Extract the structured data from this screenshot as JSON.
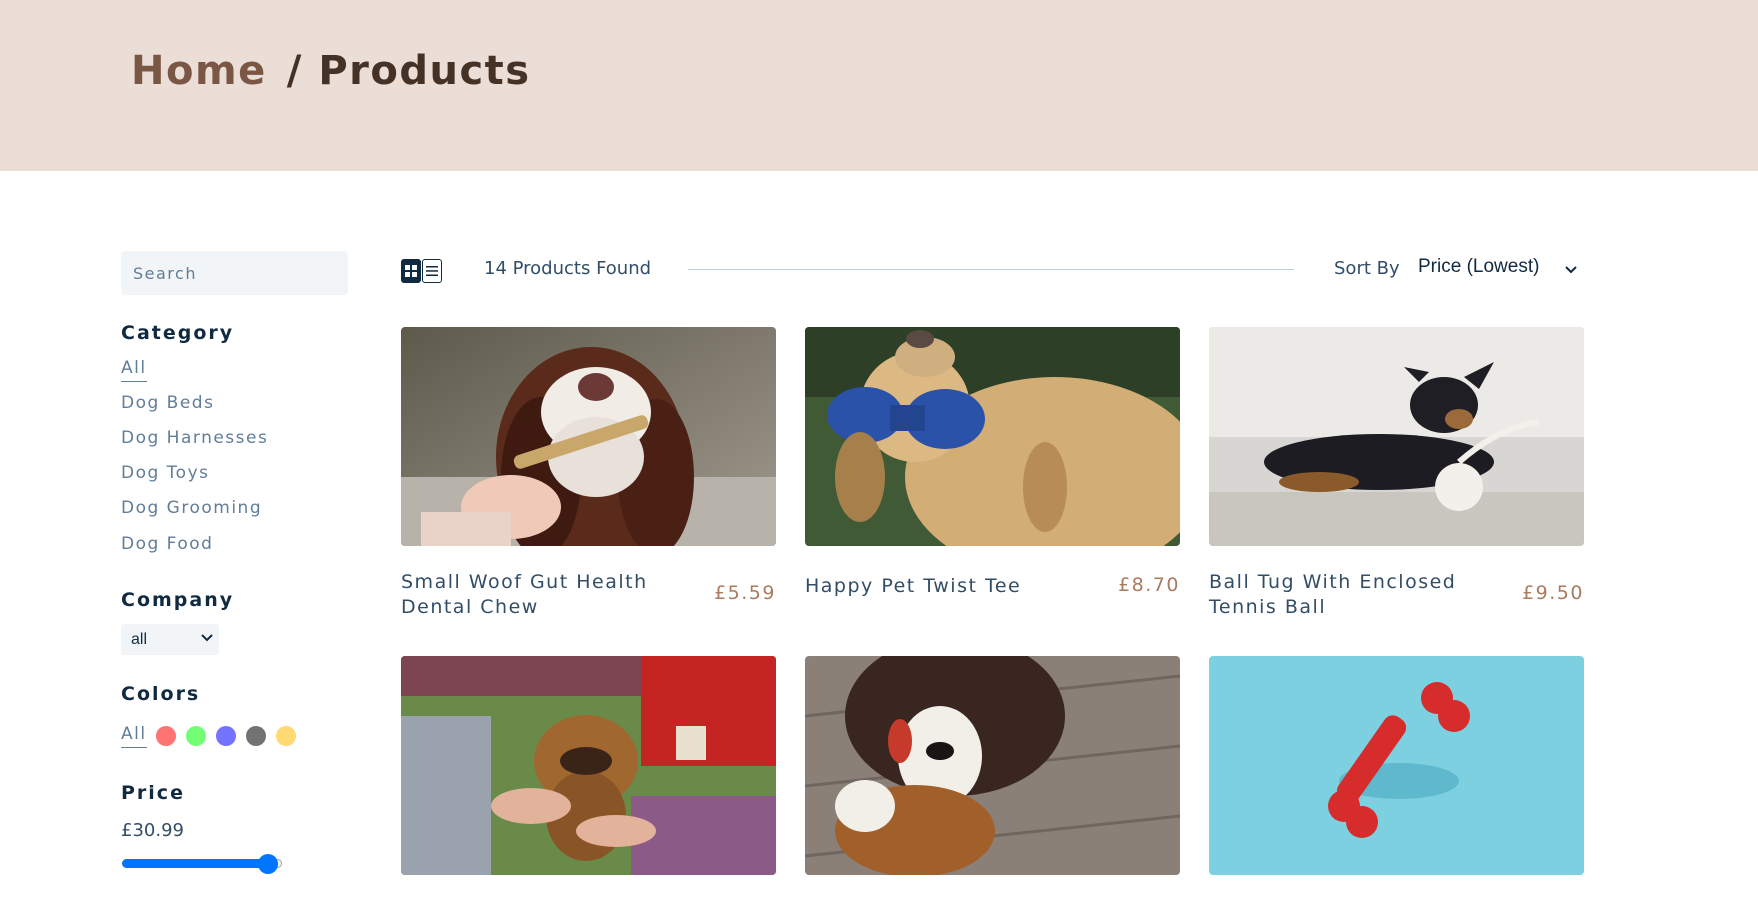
{
  "breadcrumb": {
    "home": "Home",
    "separator": "/",
    "current": "Products"
  },
  "search": {
    "placeholder": "Search",
    "value": ""
  },
  "filters": {
    "category_title": "Category",
    "categories": [
      {
        "label": "All",
        "active": true
      },
      {
        "label": "Dog Beds",
        "active": false
      },
      {
        "label": "Dog Harnesses",
        "active": false
      },
      {
        "label": "Dog Toys",
        "active": false
      },
      {
        "label": "Dog Grooming",
        "active": false
      },
      {
        "label": "Dog Food",
        "active": false
      }
    ],
    "company_title": "Company",
    "company_selected": "all",
    "colors_title": "Colors",
    "colors_all": "All",
    "colors": [
      "#ff0000",
      "#00ff00",
      "#0000ff",
      "#000000",
      "#ffb900"
    ],
    "price_title": "Price",
    "price_value": "£30.99",
    "price_slider_fraction": 0.9
  },
  "toolbar": {
    "grid_icon": "grid-view-icon",
    "list_icon": "list-view-icon",
    "count_text": "14 Products Found",
    "sort_label": "Sort By",
    "sort_selected": "Price (Lowest)"
  },
  "products": [
    {
      "name": "Small Woof Gut Health Dental Chew",
      "price": "£5.59",
      "image": "spaniel-with-chew"
    },
    {
      "name": "Happy Pet Twist Tee",
      "price": "£8.70",
      "image": "labrador-with-blue-toy"
    },
    {
      "name": "Ball Tug With Enclosed Tennis Ball",
      "price": "£9.50",
      "image": "dog-with-rope-ball"
    },
    {
      "name": "",
      "price": "",
      "image": "griffon-being-groomed"
    },
    {
      "name": "",
      "price": "",
      "image": "collie-with-plush-toy"
    },
    {
      "name": "",
      "price": "",
      "image": "red-bone-on-blue"
    }
  ],
  "colors": {
    "accent": "#ab7a5f",
    "hero_bg": "#eaded7",
    "slider": "#0075ff"
  }
}
